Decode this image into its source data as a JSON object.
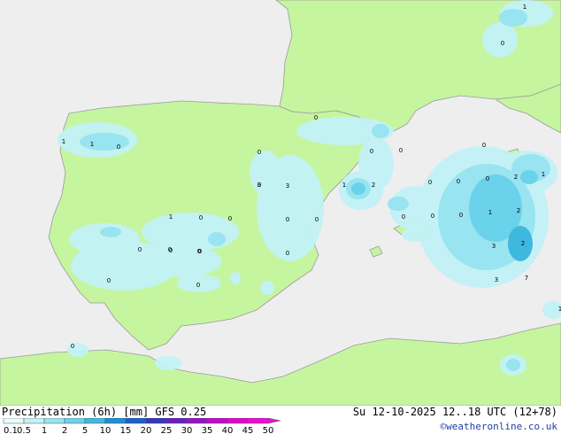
{
  "footer": {
    "title": "Precipitation (6h) [mm] GFS 0.25",
    "validity": "Su 12-10-2025 12..18 UTC (12+78)",
    "credit": "©weatheronline.co.uk"
  },
  "legend": {
    "ticks": [
      "0.1",
      "0.5",
      "1",
      "2",
      "5",
      "10",
      "15",
      "20",
      "25",
      "30",
      "35",
      "40",
      "45",
      "50"
    ],
    "colors": [
      "#e8fcfc",
      "#c2f2f6",
      "#98e4f0",
      "#6ad2ea",
      "#3fb8e0",
      "#1f8ed6",
      "#1a62c8",
      "#3a34c0",
      "#6a1ec4",
      "#9a10c8",
      "#c20ac8",
      "#e008cc",
      "#f20ad8"
    ]
  },
  "map_colors": {
    "sea": "#eeeeee",
    "land": "#c6f5a0",
    "coast": "#9a9a9a"
  },
  "value_labels": [
    "1",
    "0",
    "0",
    "1",
    "1",
    "0",
    "0",
    "0",
    "0",
    "0",
    "1",
    "2",
    "0",
    "0",
    "0",
    "2",
    "1",
    "3",
    "3",
    "0",
    "0",
    "0",
    "1",
    "2",
    "3",
    "2",
    "3",
    "7",
    "1",
    "1",
    "0",
    "0",
    "0",
    "0",
    "0",
    "0",
    "0",
    "0",
    "0",
    "0",
    "0",
    "0",
    "0",
    "0"
  ]
}
